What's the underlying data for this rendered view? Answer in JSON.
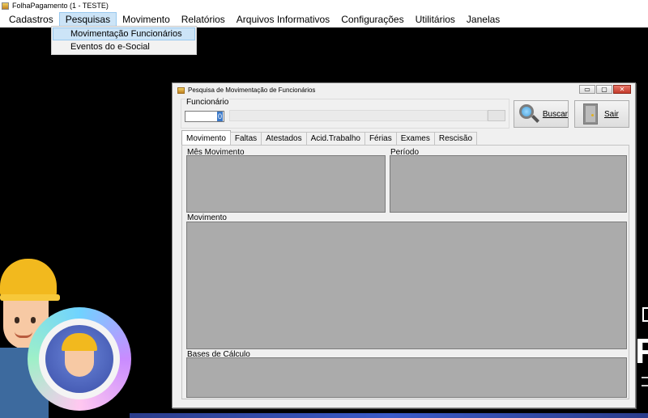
{
  "app": {
    "title": "FolhaPagamento (1 - TESTE)"
  },
  "menubar": {
    "items": [
      "Cadastros",
      "Pesquisas",
      "Movimento",
      "Relatórios",
      "Arquivos Informativos",
      "Configurações",
      "Utilitários",
      "Janelas"
    ],
    "active": "Pesquisas"
  },
  "dropdown": {
    "items": [
      "Movimentação Funcionários",
      "Eventos do e-Social"
    ],
    "highlighted": "Movimentação Funcionários"
  },
  "window": {
    "title": "Pesquisa de Movimentação de Funcionários",
    "controls": {
      "minimize": "▭",
      "maximize": "▢",
      "close": "✕"
    },
    "funcionario": {
      "label": "Funcionário",
      "code_value": "0",
      "name_value": ""
    },
    "buttons": {
      "buscar": "Buscar",
      "sair": "Sair"
    },
    "tabs": [
      "Movimento",
      "Faltas",
      "Atestados",
      "Acid.Trabalho",
      "Férias",
      "Exames",
      "Rescisão"
    ],
    "active_tab": "Movimento",
    "panels": {
      "mes_movimento": "Mês Movimento",
      "periodo": "Período",
      "movimento": "Movimento",
      "bases_calculo": "Bases de Cálculo"
    }
  },
  "colors": {
    "grid_background": "#ababab",
    "menu_highlight": "#cce4f7",
    "desktop": "#000000"
  },
  "icons": [
    "app-icon",
    "search-magnifier-icon",
    "exit-door-icon",
    "minimize-icon",
    "maximize-icon",
    "close-icon"
  ]
}
